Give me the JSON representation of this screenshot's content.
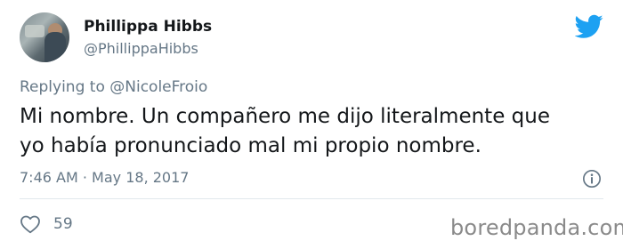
{
  "author": {
    "name": "Phillippa Hibbs",
    "handle": "@PhillippaHibbs"
  },
  "reply": {
    "prefix": "Replying to",
    "mention": "@NicoleFroio"
  },
  "tweet": {
    "line1": "Mi nombre. Un compañero me dijo literalmente que",
    "line2": "yo había pronunciado mal mi propio nombre.",
    "time": "7:46 AM",
    "separator": "·",
    "date": "May 18, 2017"
  },
  "stats": {
    "likes": "59"
  },
  "watermark": "boredpanda.com",
  "colors": {
    "twitter_blue": "#1da1f2",
    "secondary_text": "#657786",
    "primary_text": "#14171a"
  },
  "icons": {
    "brand": "twitter-bird-icon",
    "info": "info-icon",
    "like": "heart-icon"
  }
}
